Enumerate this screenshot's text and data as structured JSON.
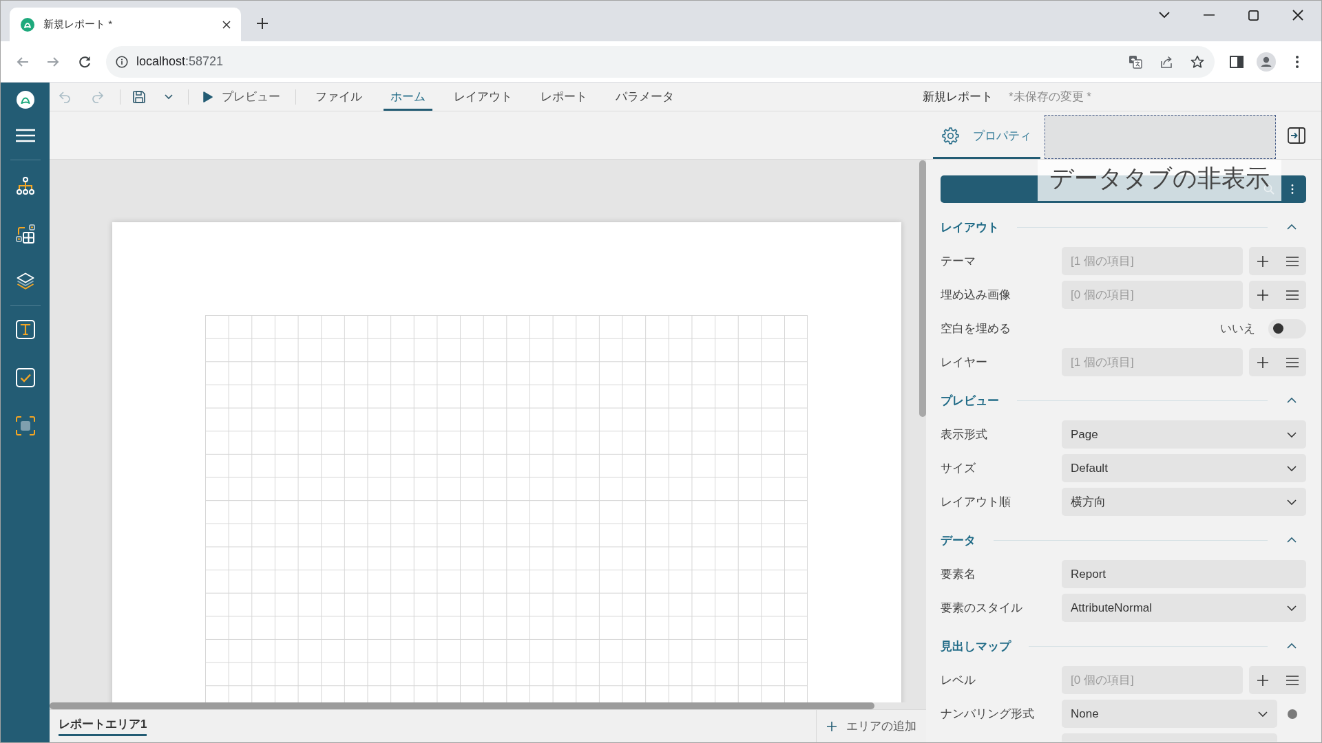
{
  "browser": {
    "tabs": [
      {
        "title": "新規レポート *",
        "selected": true
      }
    ],
    "address": {
      "host": "localhost",
      "port": ":58721"
    }
  },
  "toolbar": {
    "actions": [
      {
        "kind": "undo",
        "disabled": true
      },
      {
        "kind": "redo",
        "disabled": true
      },
      {
        "kind": "save",
        "disabled": false
      },
      {
        "kind": "menu",
        "disabled": false
      }
    ],
    "preview": "プレビュー",
    "tabs": [
      {
        "label": "ファイル",
        "selected": false
      },
      {
        "label": "ホーム",
        "selected": true
      },
      {
        "label": "レイアウト",
        "selected": false
      },
      {
        "label": "レポート",
        "selected": false
      },
      {
        "label": "パラメータ",
        "selected": false
      }
    ],
    "document_title": "新規レポート",
    "save_status": "*未保存の変更 *"
  },
  "panel": {
    "tabs": [
      {
        "kind": "tab",
        "label": "プロパティ",
        "selected": true
      },
      {
        "kind": "placeholder",
        "selected": false
      }
    ],
    "tooltip": "データタブの非表示",
    "sections": [
      {
        "title": "レイアウト",
        "expanded": true,
        "rows": [
          {
            "kind": "collection",
            "label": "テーマ",
            "value": "[1 個の項目]"
          },
          {
            "kind": "collection",
            "label": "埋め込み画像",
            "value": "[0 個の項目]"
          },
          {
            "kind": "toggle",
            "label": "空白を埋める",
            "value": "いいえ",
            "on": false
          },
          {
            "kind": "collection",
            "label": "レイヤー",
            "value": "[1 個の項目]"
          }
        ]
      },
      {
        "title": "プレビュー",
        "expanded": true,
        "rows": [
          {
            "kind": "select",
            "label": "表示形式",
            "value": "Page"
          },
          {
            "kind": "select",
            "label": "サイズ",
            "value": "Default"
          },
          {
            "kind": "select",
            "label": "レイアウト順",
            "value": "横方向"
          }
        ]
      },
      {
        "title": "データ",
        "expanded": true,
        "rows": [
          {
            "kind": "text",
            "label": "要素名",
            "value": "Report"
          },
          {
            "kind": "select",
            "label": "要素のスタイル",
            "value": "AttributeNormal"
          }
        ]
      },
      {
        "title": "見出しマップ",
        "expanded": true,
        "rows": [
          {
            "kind": "collection",
            "label": "レベル",
            "value": "[0 個の項目]"
          },
          {
            "kind": "expression",
            "label": "ナンバリング形式",
            "value": "None"
          },
          {
            "kind": "stub"
          }
        ]
      }
    ]
  },
  "footer": {
    "tabs": [
      {
        "label": "レポートエリア1",
        "selected": true
      }
    ],
    "add_area": "エリアの追加"
  }
}
